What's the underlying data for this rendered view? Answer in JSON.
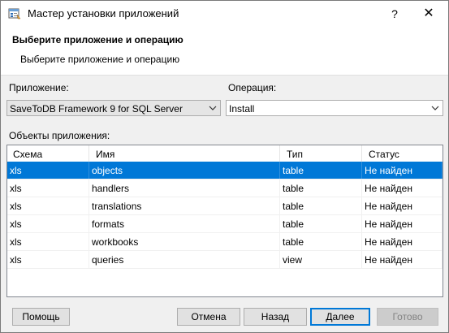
{
  "window": {
    "title": "Мастер установки приложений",
    "help_glyph": "?",
    "close_glyph": "✕",
    "icon": "wizard-app-icon"
  },
  "header": {
    "title": "Выберите приложение и операцию",
    "subtitle": "Выберите приложение и операцию"
  },
  "form": {
    "app_label": "Приложение:",
    "app_value": "SaveToDB Framework 9 for SQL Server",
    "op_label": "Операция:",
    "op_value": "Install",
    "objects_label": "Объекты приложения:"
  },
  "table": {
    "columns": [
      "Схема",
      "Имя",
      "Тип",
      "Статус"
    ],
    "rows": [
      {
        "schema": "xls",
        "name": "objects",
        "type": "table",
        "status": "Не найден",
        "selected": true
      },
      {
        "schema": "xls",
        "name": "handlers",
        "type": "table",
        "status": "Не найден",
        "selected": false
      },
      {
        "schema": "xls",
        "name": "translations",
        "type": "table",
        "status": "Не найден",
        "selected": false
      },
      {
        "schema": "xls",
        "name": "formats",
        "type": "table",
        "status": "Не найден",
        "selected": false
      },
      {
        "schema": "xls",
        "name": "workbooks",
        "type": "table",
        "status": "Не найден",
        "selected": false
      },
      {
        "schema": "xls",
        "name": "queries",
        "type": "view",
        "status": "Не найден",
        "selected": false
      }
    ]
  },
  "buttons": {
    "help": "Помощь",
    "cancel": "Отмена",
    "back": "Назад",
    "next": "Далее",
    "finish": "Готово"
  },
  "colors": {
    "selection": "#0078d7",
    "default_button_border": "#0078d7"
  }
}
